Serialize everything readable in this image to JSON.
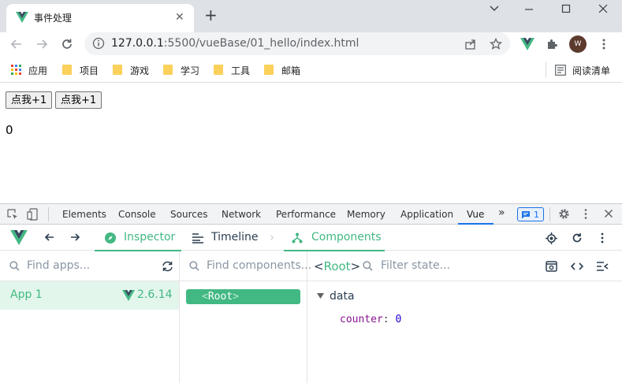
{
  "browser": {
    "tab_title": "事件处理",
    "url_host": "127.0.0.1",
    "url_path": ":5500/vueBase/01_hello/index.html",
    "avatar_letter": "W",
    "bookmarks": [
      "应用",
      "项目",
      "游戏",
      "学习",
      "工具",
      "邮箱"
    ],
    "reading_list": "阅读清单"
  },
  "page": {
    "button1": "点我+1",
    "button2": "点我+1",
    "counter": "0"
  },
  "devtools": {
    "tabs": [
      "Elements",
      "Console",
      "Sources",
      "Network",
      "Performance",
      "Memory",
      "Application",
      "Vue"
    ],
    "badge_count": "1",
    "vue": {
      "nav": {
        "inspector": "Inspector",
        "timeline": "Timeline",
        "components": "Components"
      },
      "find_apps_placeholder": "Find apps...",
      "find_components_placeholder": "Find components...",
      "filter_state_placeholder": "Filter state...",
      "app_name": "App 1",
      "vue_version": "2.6.14",
      "root_component": "Root",
      "state_section": "data",
      "state_key": "counter",
      "state_value": "0"
    }
  },
  "colors": {
    "vue_green": "#42b883",
    "vue_dark": "#35495e",
    "chrome_blue": "#1a73e8"
  }
}
